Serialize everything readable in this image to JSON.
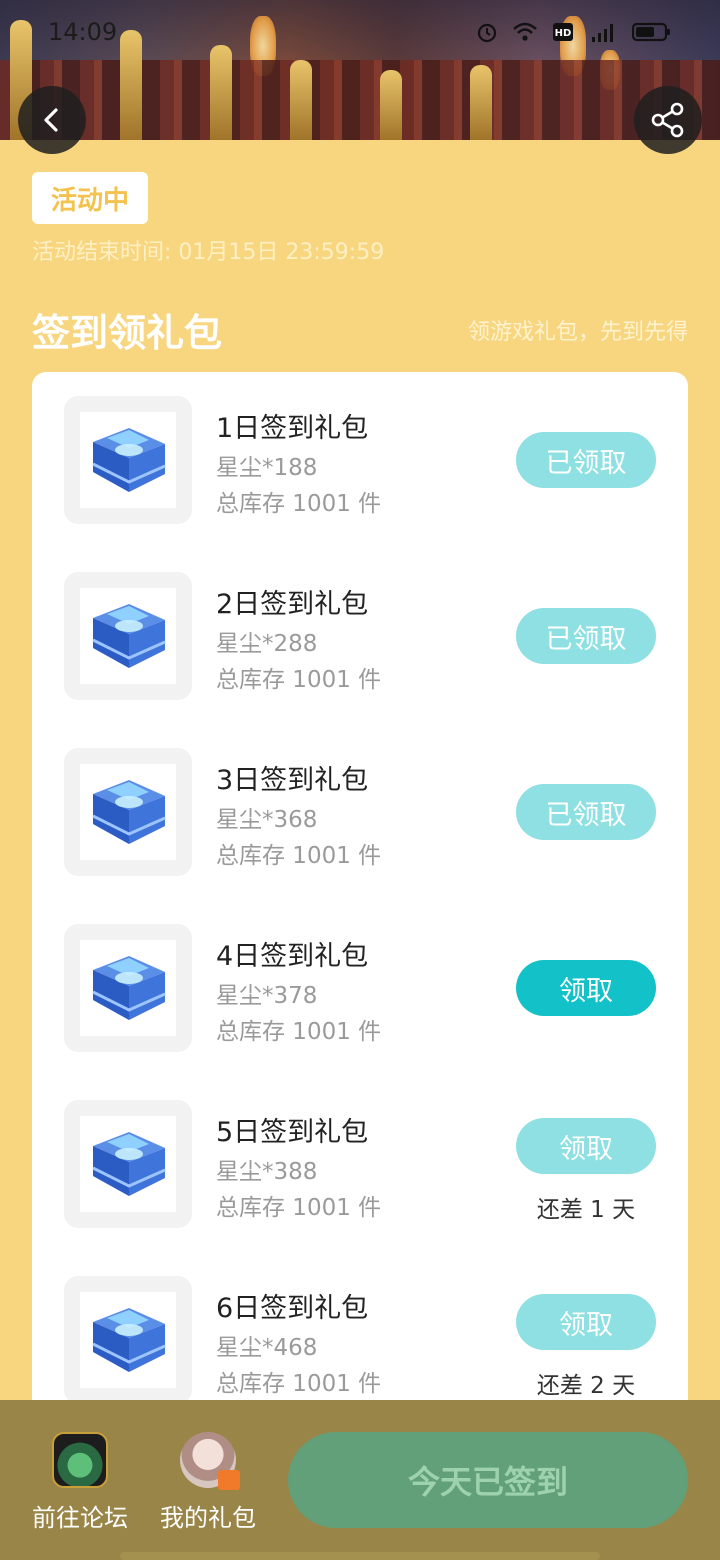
{
  "status_bar": {
    "time": "14:09",
    "icons": [
      "alarm-icon",
      "wifi-icon",
      "hd-icon",
      "4g-signal-icon",
      "battery-icon"
    ]
  },
  "activity": {
    "badge": "活动中",
    "end_time": "活动结束时间: 01月15日 23:59:59"
  },
  "section": {
    "title": "签到领礼包",
    "subtitle": "领游戏礼包，先到先得"
  },
  "gifts": [
    {
      "title": "1日签到礼包",
      "reward": "星尘*188",
      "stock": "总库存 1001 件",
      "button": "已领取",
      "state": "done",
      "remain": ""
    },
    {
      "title": "2日签到礼包",
      "reward": "星尘*288",
      "stock": "总库存 1001 件",
      "button": "已领取",
      "state": "done",
      "remain": ""
    },
    {
      "title": "3日签到礼包",
      "reward": "星尘*368",
      "stock": "总库存 1001 件",
      "button": "已领取",
      "state": "done",
      "remain": ""
    },
    {
      "title": "4日签到礼包",
      "reward": "星尘*378",
      "stock": "总库存 1001 件",
      "button": "领取",
      "state": "active",
      "remain": ""
    },
    {
      "title": "5日签到礼包",
      "reward": "星尘*388",
      "stock": "总库存 1001 件",
      "button": "领取",
      "state": "pending",
      "remain": "还差 1 天"
    },
    {
      "title": "6日签到礼包",
      "reward": "星尘*468",
      "stock": "总库存 1001 件",
      "button": "领取",
      "state": "pending",
      "remain": "还差 2 天"
    }
  ],
  "bottom_bar": {
    "forum_label": "前往论坛",
    "my_gifts_label": "我的礼包",
    "checkin_label": "今天已签到"
  },
  "colors": {
    "page_bg": "#f8d680",
    "done_button": "#8ee0e2",
    "active_button": "#13c1c8",
    "checkin_button": "#62a079",
    "bottom_bar": "#9a8548"
  }
}
